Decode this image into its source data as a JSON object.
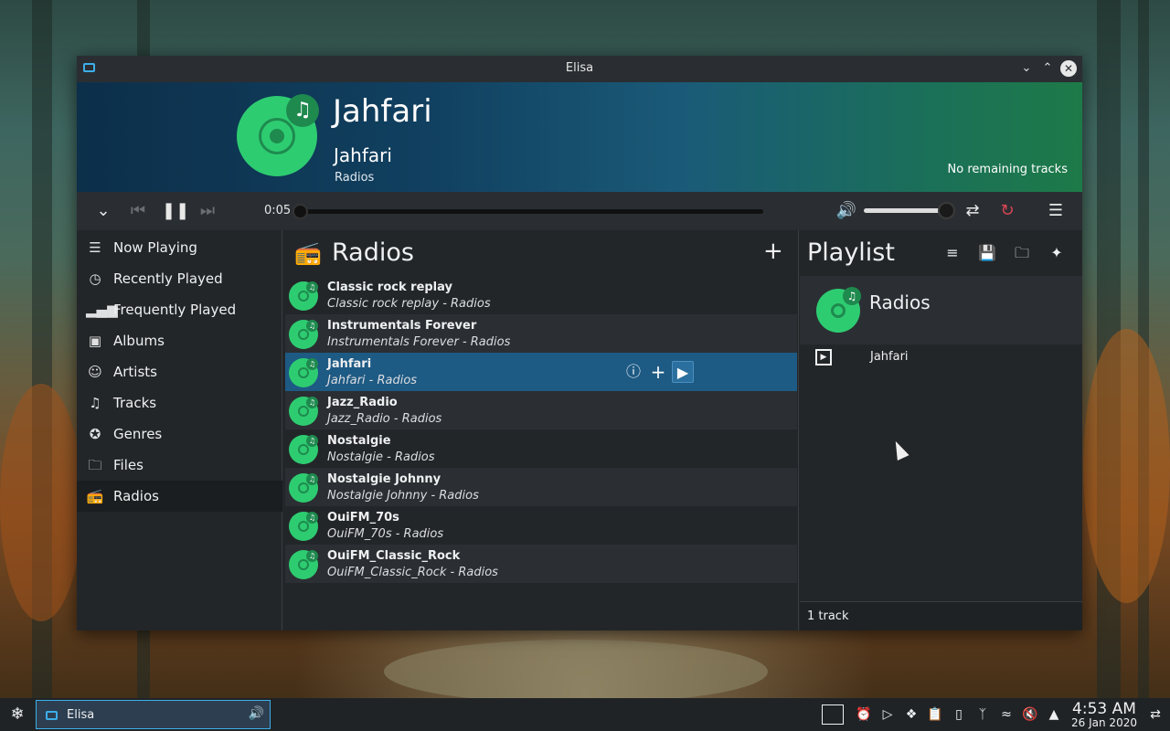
{
  "window": {
    "title": "Elisa"
  },
  "header": {
    "title": "Jahfari",
    "artist": "Jahfari",
    "album": "Radios",
    "remaining": "No remaining tracks"
  },
  "controls": {
    "time": "0:05",
    "seek_fraction": 0,
    "volume_fraction": 0.95
  },
  "sidebar": {
    "items": [
      {
        "label": "Now Playing",
        "icon": "now-playing-icon"
      },
      {
        "label": "Recently Played",
        "icon": "clock-icon"
      },
      {
        "label": "Frequently Played",
        "icon": "bars-icon"
      },
      {
        "label": "Albums",
        "icon": "album-icon"
      },
      {
        "label": "Artists",
        "icon": "person-icon"
      },
      {
        "label": "Tracks",
        "icon": "music-note-icon"
      },
      {
        "label": "Genres",
        "icon": "badge-icon"
      },
      {
        "label": "Files",
        "icon": "folder-icon"
      },
      {
        "label": "Radios",
        "icon": "radio-icon"
      }
    ],
    "active": "Radios"
  },
  "radios": {
    "title": "Radios",
    "rows": [
      {
        "title": "Classic rock replay",
        "subtitle": "Classic rock replay - Radios"
      },
      {
        "title": "Instrumentals Forever",
        "subtitle": "Instrumentals Forever - Radios"
      },
      {
        "title": "Jahfari",
        "subtitle": "Jahfari - Radios"
      },
      {
        "title": "Jazz_Radio",
        "subtitle": "Jazz_Radio - Radios"
      },
      {
        "title": "Nostalgie",
        "subtitle": "Nostalgie - Radios"
      },
      {
        "title": "Nostalgie Johnny",
        "subtitle": "Nostalgie Johnny - Radios"
      },
      {
        "title": "OuiFM_70s",
        "subtitle": "OuiFM_70s - Radios"
      },
      {
        "title": "OuiFM_Classic_Rock",
        "subtitle": "OuiFM_Classic_Rock - Radios"
      }
    ],
    "selected_index": 2
  },
  "playlist": {
    "title": "Playlist",
    "group_title": "Radios",
    "tracks": [
      {
        "name": "Jahfari"
      }
    ],
    "footer": "1 track"
  },
  "taskbar": {
    "task_label": "Elisa",
    "time": "4:53 AM",
    "date": "26 Jan 2020"
  },
  "colors": {
    "accent": "#3daee9",
    "selection": "#1d5a84",
    "cover_green": "#2ecc71",
    "window_bg": "#232629"
  }
}
